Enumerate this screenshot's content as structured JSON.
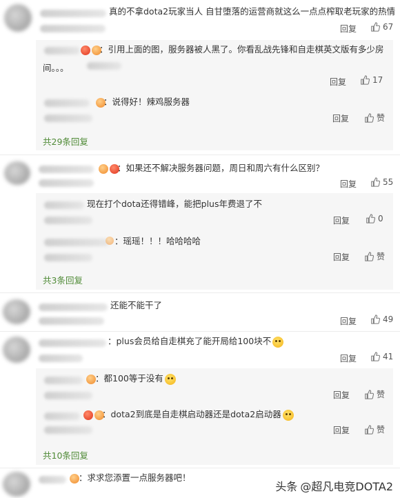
{
  "comments": [
    {
      "text": "真的不拿dota2玩家当人 自甘堕落的运营商就这么一点点榨取老玩家的热情",
      "reply": "回复",
      "likes": "67",
      "subs": [
        {
          "text": "：引用上面的图，服务器被人黑了。你看乱战先锋和自走棋英文版有多少房",
          "text2": "间。。。",
          "reply": "回复",
          "likes": "17"
        },
        {
          "text": "：说得好！辣鸡服务器",
          "reply": "回复",
          "likes": "赞"
        }
      ],
      "more": "共29条回复"
    },
    {
      "text": "：如果还不解决服务器问题，周日和周六有什么区别？",
      "reply": "回复",
      "likes": "55",
      "subs": [
        {
          "text": "现在打个dota还得错峰，能把plus年费退了不",
          "reply": "回复",
          "likes": "0"
        },
        {
          "text": "：瑶瑶！！！哈哈哈哈",
          "reply": "回复",
          "likes": "赞"
        }
      ],
      "more": "共3条回复"
    },
    {
      "text": "还能不能干了",
      "reply": "回复",
      "likes": "49"
    },
    {
      "text": "：plus会员给自走棋充了能开局给100块不",
      "reply": "回复",
      "likes": "41",
      "subs": [
        {
          "text": "：都100等于没有",
          "reply": "回复",
          "likes": "赞"
        },
        {
          "text": "：dota2到底是自走棋启动器还是dota2启动器",
          "reply": "回复",
          "likes": "赞"
        }
      ],
      "more": "共10条回复"
    },
    {
      "text": "：求求您添置一点服务器吧！"
    }
  ],
  "watermark": {
    "source": "头条",
    "handle": "@超凡电竞DOTA2"
  }
}
